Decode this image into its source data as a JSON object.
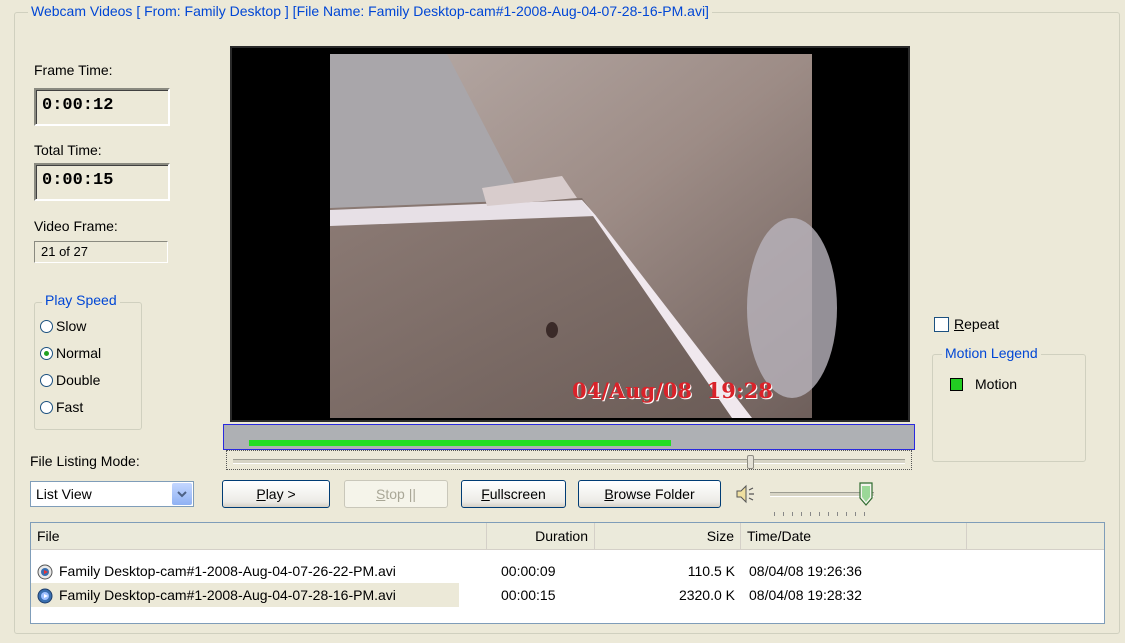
{
  "group_title": "Webcam Videos  [ From: Family Desktop ]  [File Name: Family Desktop-cam#1-2008-Aug-04-07-28-16-PM.avi]",
  "frame_time": {
    "label": "Frame Time:",
    "value": "0:00:12"
  },
  "total_time": {
    "label": "Total Time:",
    "value": "0:00:15"
  },
  "video_frame": {
    "label": "Video Frame:",
    "value": "21 of 27"
  },
  "play_speed": {
    "title": "Play Speed",
    "options": [
      {
        "label": "Slow",
        "checked": false
      },
      {
        "label": "Normal",
        "checked": true
      },
      {
        "label": "Double",
        "checked": false
      },
      {
        "label": "Fast",
        "checked": false
      }
    ]
  },
  "file_listing": {
    "label": "File Listing Mode:",
    "selected": "List View"
  },
  "video": {
    "timestamp": "04/Aug/08  19:28"
  },
  "progress": {
    "fraction": 0.66,
    "color": "#22dd22"
  },
  "position_slider": {
    "fraction": 0.77
  },
  "volume": {
    "fraction": 0.95
  },
  "buttons": {
    "play": "Play >",
    "stop": "Stop ||",
    "fullscreen": "Fullscreen",
    "browse": "Browse Folder"
  },
  "repeat": {
    "label": "Repeat",
    "checked": false
  },
  "motion_legend": {
    "title": "Motion Legend",
    "item": "Motion",
    "color": "#22cc22"
  },
  "file_list": {
    "headers": {
      "file": "File",
      "duration": "Duration",
      "size": "Size",
      "date": "Time/Date"
    },
    "rows": [
      {
        "file": "Family Desktop-cam#1-2008-Aug-04-07-26-22-PM.avi",
        "duration": "00:00:09",
        "size": "110.5 K",
        "date": "08/04/08 19:26:36",
        "selected": false
      },
      {
        "file": "Family Desktop-cam#1-2008-Aug-04-07-28-16-PM.avi",
        "duration": "00:00:15",
        "size": "2320.0 K",
        "date": "08/04/08 19:28:32",
        "selected": true
      }
    ]
  }
}
